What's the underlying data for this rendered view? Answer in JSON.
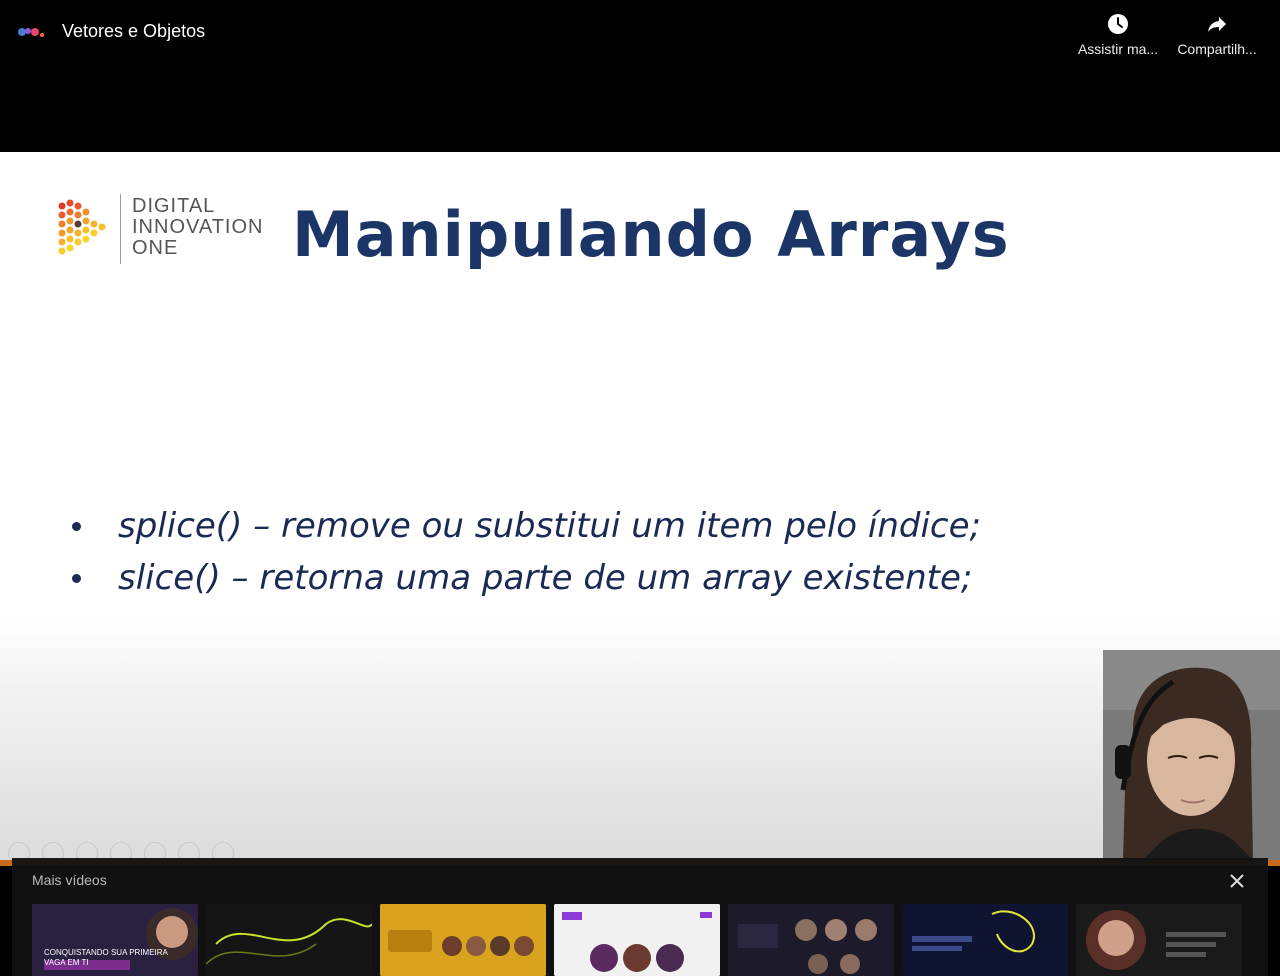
{
  "header": {
    "channel_logo_icon": "dio-logo-icon",
    "title": "Vetores e Objetos",
    "actions": [
      {
        "icon": "clock-icon",
        "label": "Assistir ma..."
      },
      {
        "icon": "share-icon",
        "label": "Compartilh..."
      }
    ]
  },
  "slide": {
    "logo_lines": [
      "DIGITAL",
      "INNOVATION",
      "ONE"
    ],
    "title": "Manipulando Arrays",
    "bullets": [
      "splice() – remove ou substitui um item pelo índice;",
      "slice() – retorna uma parte de um array existente;"
    ]
  },
  "more_videos": {
    "title": "Mais vídeos",
    "close_icon": "close-icon",
    "thumbnails": [
      {
        "caption": "CONQUISTANDO SUA PRIMEIRA VAGA EM TI",
        "color": "#2a2140"
      },
      {
        "caption": "",
        "color": "#151515"
      },
      {
        "caption": "",
        "color": "#d9a21f"
      },
      {
        "caption": "",
        "color": "#f1f1f1"
      },
      {
        "caption": "",
        "color": "#1d1a2b"
      },
      {
        "caption": "",
        "color": "#0f1530"
      },
      {
        "caption": "",
        "color": "#1a1a1a"
      }
    ]
  },
  "colors": {
    "title_blue": "#1a3566",
    "progress_orange": "#c96a1c"
  }
}
